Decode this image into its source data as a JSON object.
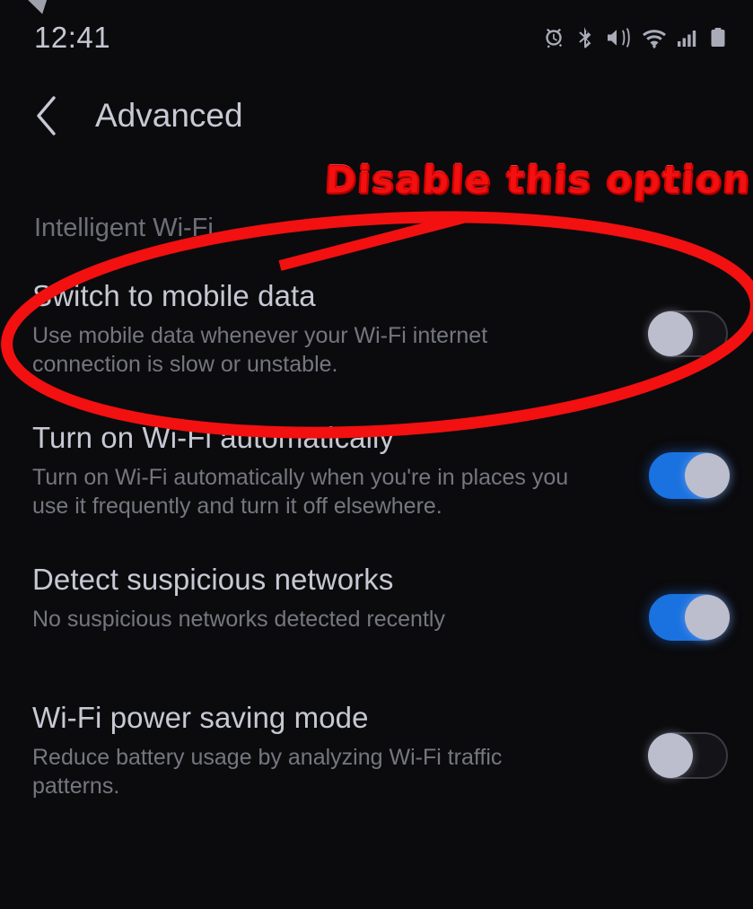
{
  "status_bar": {
    "time": "12:41",
    "icons": [
      {
        "name": "alarm-icon",
        "label": "alarm"
      },
      {
        "name": "bluetooth-icon",
        "label": "bluetooth"
      },
      {
        "name": "vibrate-icon",
        "label": "vibrate"
      },
      {
        "name": "wifi-icon",
        "label": "wi-fi"
      },
      {
        "name": "signal-icon",
        "label": "mobile signal"
      },
      {
        "name": "battery-icon",
        "label": "battery"
      }
    ]
  },
  "header": {
    "back_label": "Back",
    "title": "Advanced"
  },
  "section": {
    "label": "Intelligent Wi-Fi"
  },
  "annotation": {
    "text": "Disable this option",
    "color": "#f21010",
    "shape": "ellipse + pointer line",
    "target": "Switch to mobile data"
  },
  "settings": [
    {
      "title": "Switch to mobile data",
      "subtitle": "Use mobile data whenever your Wi-Fi internet connection is slow or unstable.",
      "toggle": "off",
      "name": "switch-to-mobile-data"
    },
    {
      "title": "Turn on Wi-Fi automatically",
      "subtitle": "Turn on Wi-Fi automatically when you're in places you use it frequently and turn it off elsewhere.",
      "toggle": "on",
      "name": "turn-on-wifi-automatically"
    },
    {
      "title": "Detect suspicious networks",
      "subtitle": "No suspicious networks detected recently",
      "toggle": "on",
      "name": "detect-suspicious-networks"
    },
    {
      "title": "Wi-Fi power saving mode",
      "subtitle": "Reduce battery usage by analyzing Wi-Fi traffic patterns.",
      "toggle": "off",
      "name": "wifi-power-saving-mode"
    }
  ],
  "colors": {
    "background": "#0b0b0d",
    "title_text": "#c6c8d3",
    "subtitle_text": "#75777f",
    "toggle_on": "#1a72e0",
    "knob": "#bcbecd",
    "annotation_red": "#f21010"
  }
}
